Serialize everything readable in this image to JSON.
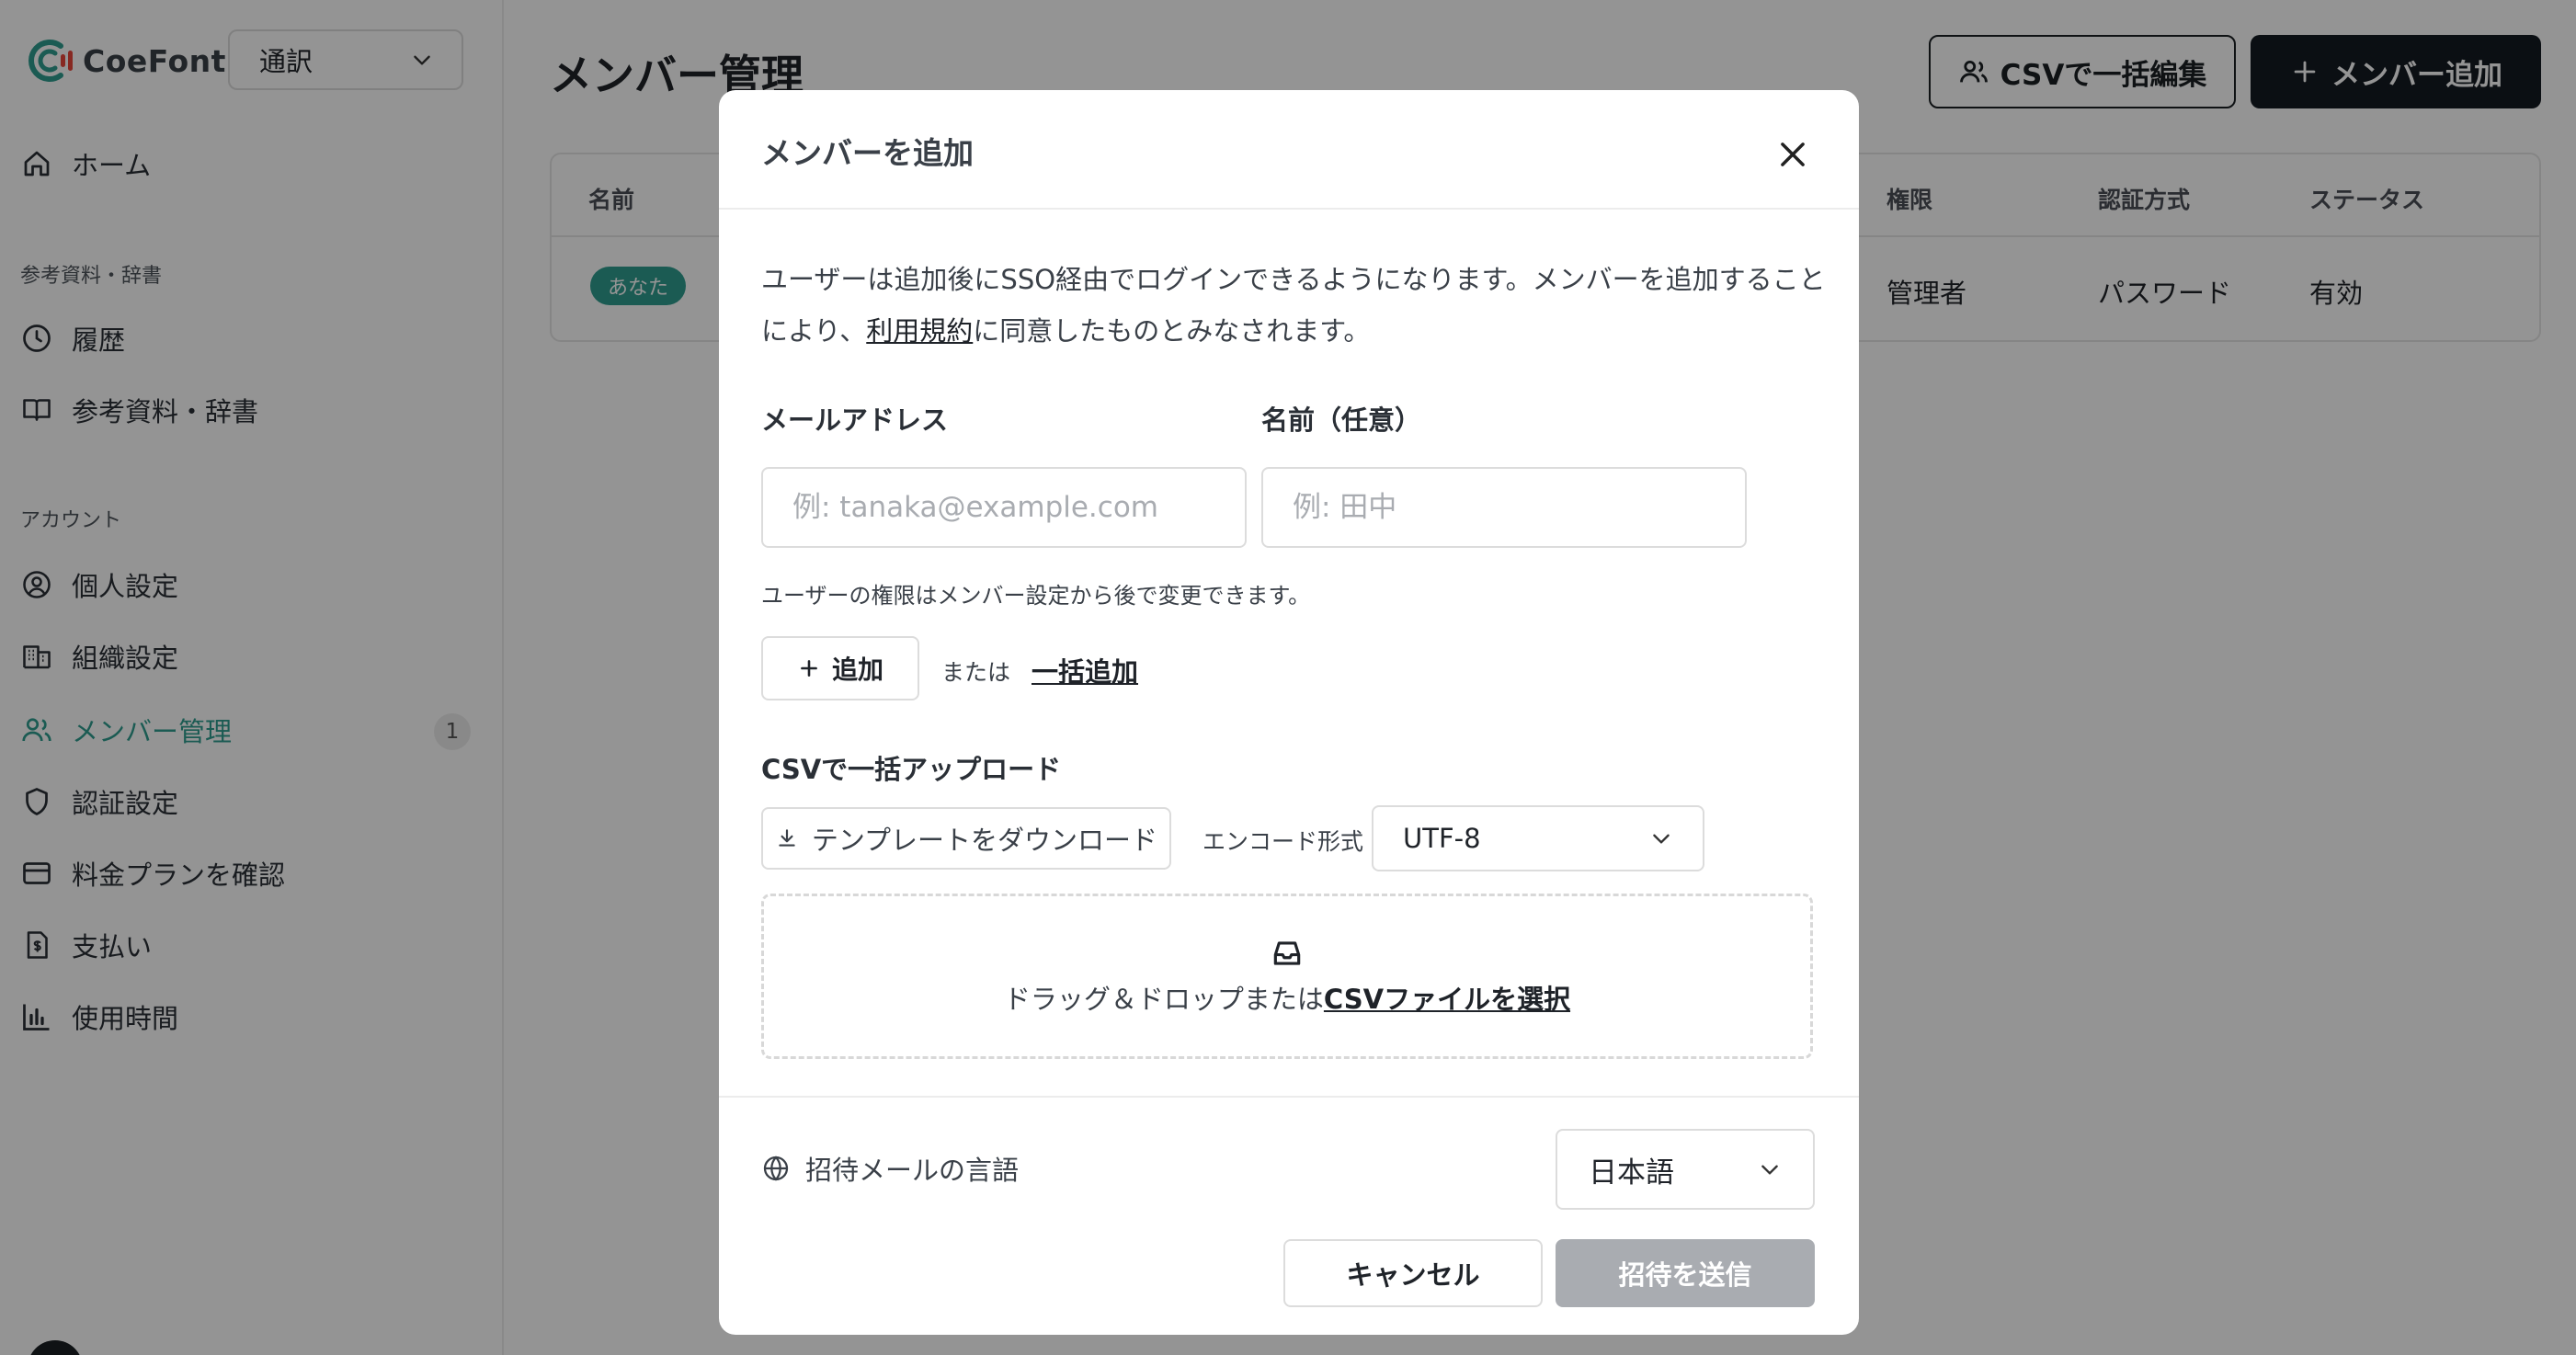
{
  "brand": {
    "name": "CoeFont",
    "logo_icon": "coefont-logo-icon"
  },
  "mode_select": {
    "value": "通訳"
  },
  "sidebar": {
    "home": {
      "label": "ホーム",
      "icon": "home-icon"
    },
    "section_reference": "参考資料・辞書",
    "history": {
      "label": "履歴",
      "icon": "clock-icon"
    },
    "reference": {
      "label": "参考資料・辞書",
      "icon": "book-icon"
    },
    "section_account": "アカウント",
    "personal": {
      "label": "個人設定",
      "icon": "user-circle-icon"
    },
    "org": {
      "label": "組織設定",
      "icon": "building-icon"
    },
    "members": {
      "label": "メンバー管理",
      "icon": "users-icon",
      "badge": "1"
    },
    "auth": {
      "label": "認証設定",
      "icon": "shield-icon"
    },
    "plan": {
      "label": "料金プランを確認",
      "icon": "credit-card-icon"
    },
    "payment": {
      "label": "支払い",
      "icon": "receipt-icon"
    },
    "usage": {
      "label": "使用時間",
      "icon": "bar-chart-icon"
    }
  },
  "page": {
    "title": "メンバー管理",
    "csv_edit_label": "CSVで一括編集",
    "add_member_label": "メンバー追加"
  },
  "table": {
    "headers": {
      "name": "名前",
      "role": "権限",
      "auth": "認証方式",
      "status": "ステータス"
    },
    "row": {
      "badge": "あなた",
      "role": "管理者",
      "auth": "パスワード",
      "status": "有効"
    }
  },
  "modal": {
    "title": "メンバーを追加",
    "intro_before": "ユーザーは追加後にSSO経由でログインできるようになります。メンバーを追加することにより、",
    "intro_link": "利用規約",
    "intro_after": "に同意したものとみなされます。",
    "email_label": "メールアドレス",
    "email_placeholder": "例: tanaka@example.com",
    "name_label": "名前（任意）",
    "name_placeholder": "例: 田中",
    "hint": "ユーザーの権限はメンバー設定から後で変更できます。",
    "add_label": "追加",
    "or_text": "または",
    "bulk_link": "一括追加",
    "csv_title": "CSVで一括アップロード",
    "template_label": "テンプレートをダウンロード",
    "encoding_label": "エンコード形式",
    "encoding_value": "UTF-8",
    "drop_text": "ドラッグ＆ドロップまたは",
    "drop_link": "CSVファイルを選択",
    "lang_label": "招待メールの言語",
    "lang_value": "日本語",
    "cancel_label": "キャンセル",
    "send_label": "招待を送信"
  },
  "colors": {
    "accent": "#2f9e8f",
    "dark": "#131a22",
    "disabled": "#a9acb1",
    "logo_red": "#e8473b"
  }
}
